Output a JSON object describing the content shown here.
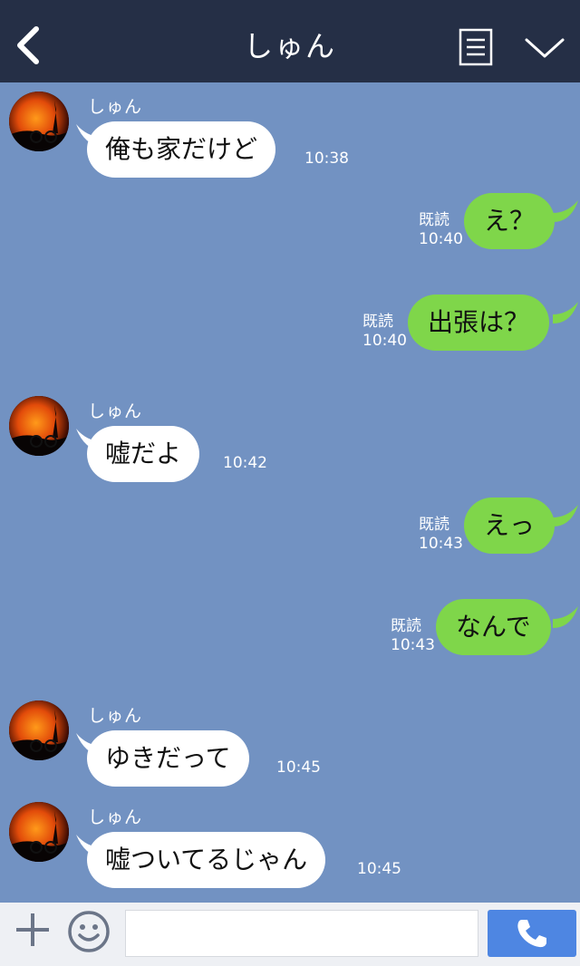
{
  "header": {
    "title": "しゅん",
    "back_icon": "chevron-left-icon",
    "menu_icon": "menu-icon",
    "collapse_icon": "chevron-down-icon"
  },
  "messages": [
    {
      "side": "in",
      "sender": "しゅん",
      "text": "俺も家だけど",
      "time": "10:38"
    },
    {
      "side": "out",
      "read": "既読",
      "text": "え？",
      "time": "10:40"
    },
    {
      "side": "out",
      "read": "既読",
      "text": "出張は？",
      "time": "10:40"
    },
    {
      "side": "in",
      "sender": "しゅん",
      "text": "嘘だよ",
      "time": "10:42"
    },
    {
      "side": "out",
      "read": "既読",
      "text": "えっ",
      "time": "10:43"
    },
    {
      "side": "out",
      "read": "既読",
      "text": "なんで",
      "time": "10:43"
    },
    {
      "side": "in",
      "sender": "しゅん",
      "text": "ゆきだって",
      "time": "10:45"
    },
    {
      "side": "in",
      "sender": "しゅん",
      "text": "嘘ついてるじゃん",
      "time": "10:45"
    }
  ],
  "input": {
    "value": "",
    "placeholder": ""
  },
  "colors": {
    "header_bg": "#252f46",
    "chat_bg": "#7292c2",
    "incoming_bubble": "#ffffff",
    "outgoing_bubble": "#7fd64a",
    "call_button": "#4e86e2"
  },
  "icons": {
    "plus": "plus-icon",
    "emoji": "smiley-icon",
    "call": "phone-icon"
  }
}
